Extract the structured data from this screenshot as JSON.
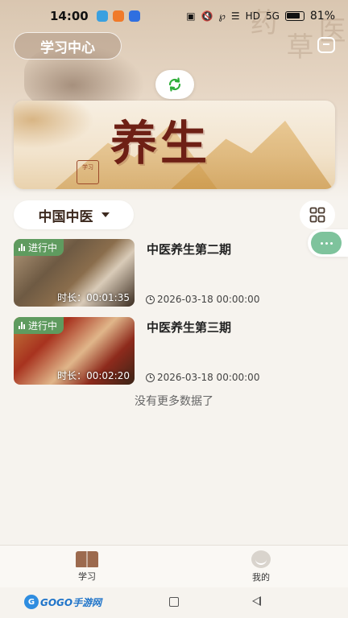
{
  "status_bar": {
    "time": "14:00",
    "battery": "81%",
    "hd_label": "HD",
    "signal_label": "5G"
  },
  "header": {
    "learning_center_label": "学习中心"
  },
  "banner": {
    "title": "养生",
    "seal_text": "学习"
  },
  "filter": {
    "category_label": "中国中医"
  },
  "courses": [
    {
      "badge": "进行中",
      "duration": "时长：00:01:35",
      "title": "中医养生第二期",
      "date": "2026-03-18 00:00:00"
    },
    {
      "badge": "进行中",
      "duration": "时长：00:02:20",
      "title": "中医养生第三期",
      "date": "2026-03-18 00:00:00"
    }
  ],
  "list_footer": "没有更多数据了",
  "tabs": [
    {
      "label": "学习",
      "icon": "book-icon"
    },
    {
      "label": "我的",
      "icon": "profile-icon"
    }
  ],
  "watermark": {
    "brand": "GOGO手游网"
  },
  "colors": {
    "badge_green": "#5f9b5f",
    "float_green": "#7ec39c",
    "banner_title": "#6e2015",
    "background": "#f6f3ee"
  }
}
